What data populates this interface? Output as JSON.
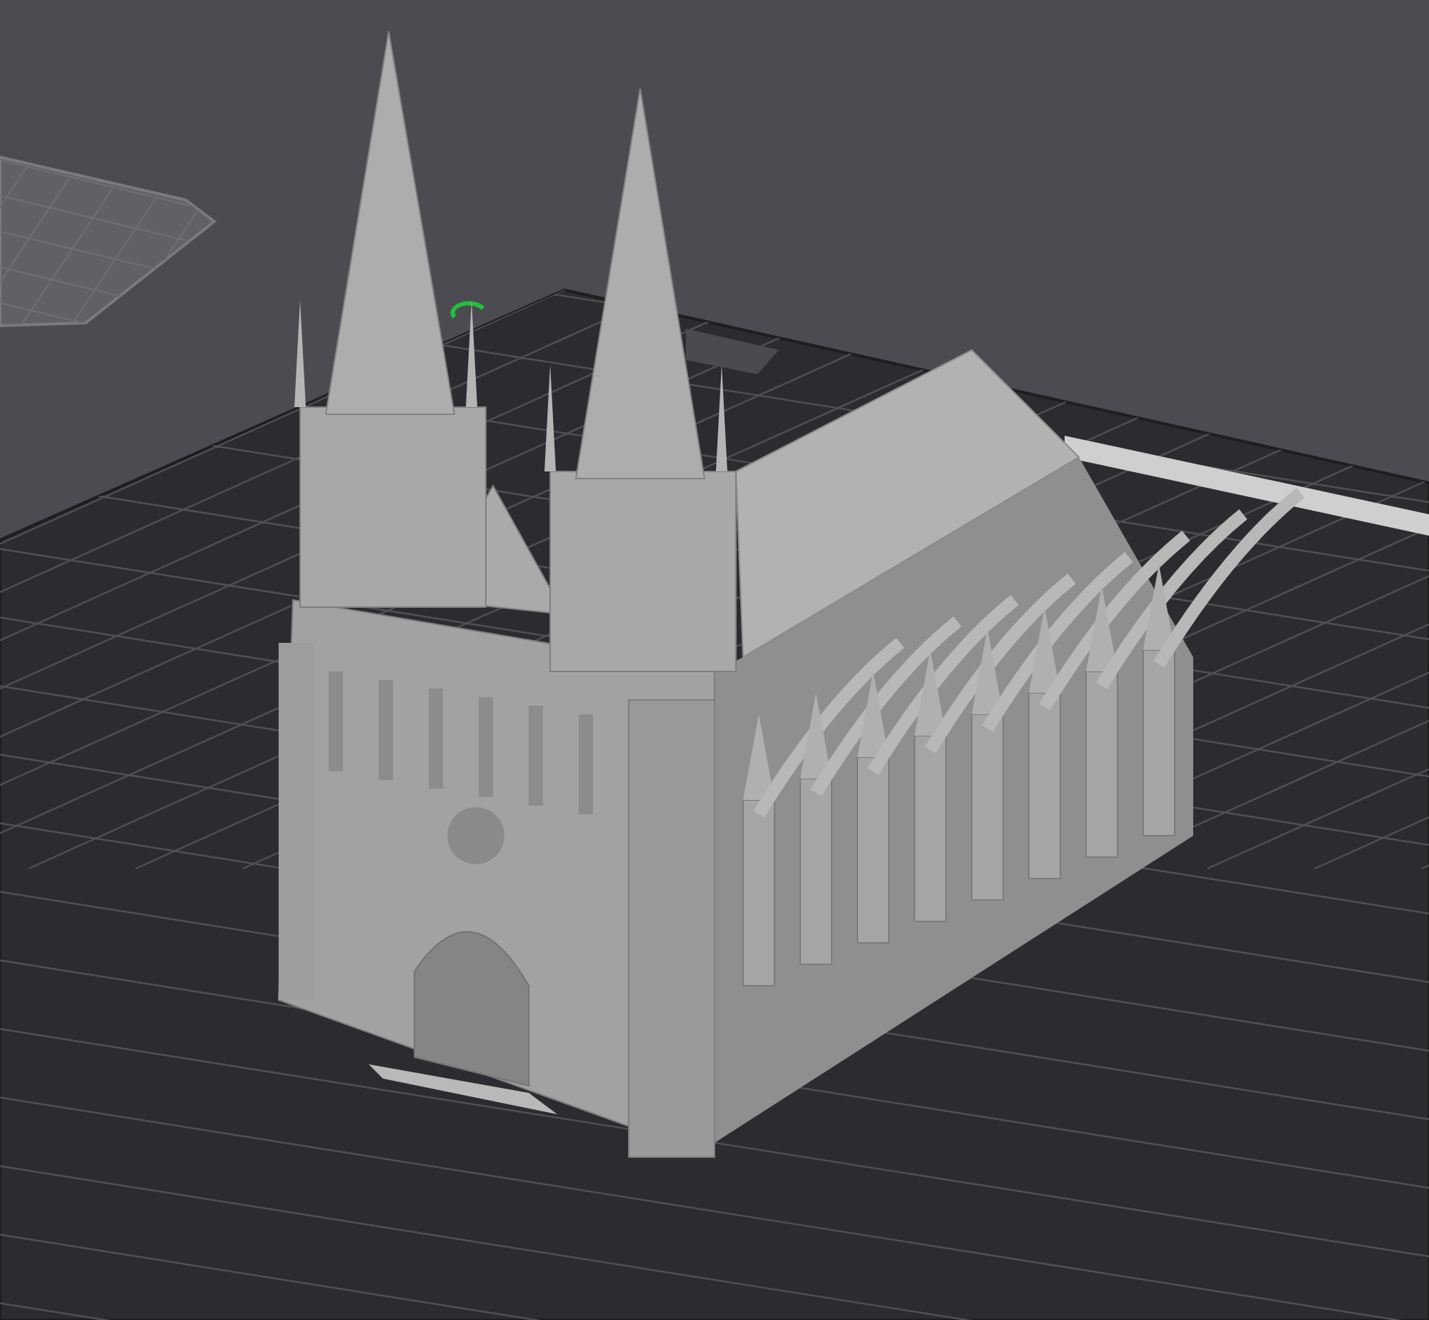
{
  "viewport": {
    "plates": [
      {
        "selected": false
      },
      {
        "selected": true
      }
    ]
  }
}
